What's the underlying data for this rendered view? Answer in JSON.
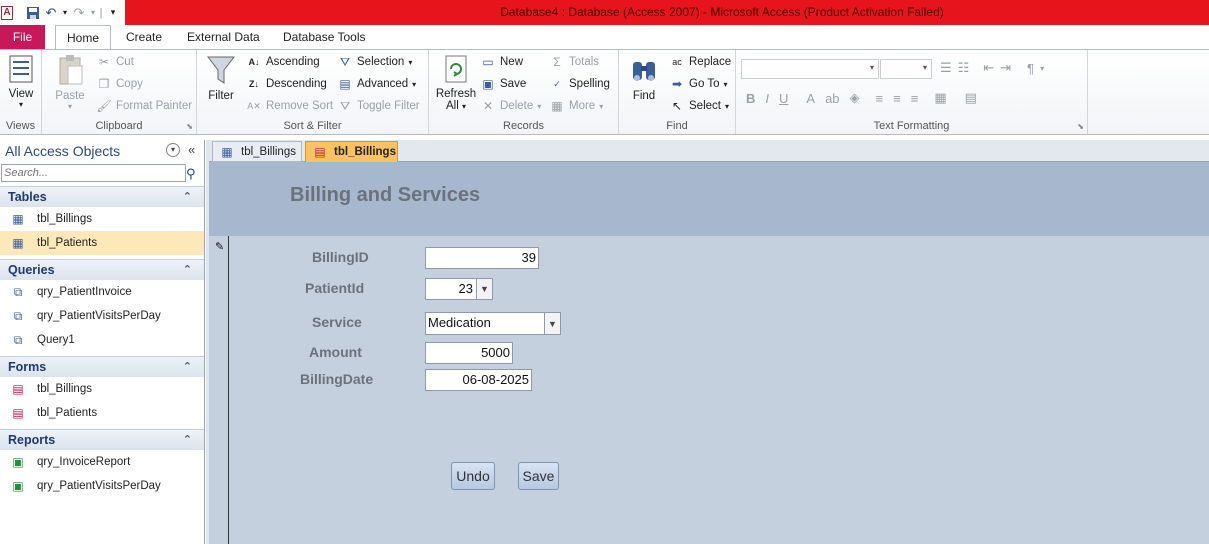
{
  "window": {
    "title": "Database4 : Database (Access 2007)  -  Microsoft Access (Product Activation Failed)"
  },
  "ribbon_tabs": [
    "File",
    "Home",
    "Create",
    "External Data",
    "Database Tools"
  ],
  "ribbon": {
    "views": {
      "view": "View",
      "label": "Views"
    },
    "clipboard": {
      "paste": "Paste",
      "cut": "Cut",
      "copy": "Copy",
      "format_painter": "Format Painter",
      "label": "Clipboard"
    },
    "sort_filter": {
      "filter": "Filter",
      "ascending": "Ascending",
      "descending": "Descending",
      "remove_sort": "Remove Sort",
      "selection": "Selection",
      "advanced": "Advanced",
      "toggle_filter": "Toggle Filter",
      "label": "Sort & Filter"
    },
    "records": {
      "refresh": "Refresh",
      "refresh_all": "All",
      "new": "New",
      "save": "Save",
      "delete": "Delete",
      "totals": "Totals",
      "spelling": "Spelling",
      "more": "More",
      "label": "Records"
    },
    "find": {
      "find": "Find",
      "replace": "Replace",
      "goto": "Go To",
      "select": "Select",
      "label": "Find"
    },
    "text_formatting": {
      "label": "Text Formatting"
    }
  },
  "nav": {
    "header": "All Access Objects",
    "search_placeholder": "Search...",
    "categories": [
      {
        "name": "Tables",
        "items": [
          "tbl_Billings",
          "tbl_Patients"
        ]
      },
      {
        "name": "Queries",
        "items": [
          "qry_PatientInvoice",
          "qry_PatientVisitsPerDay",
          "Query1"
        ]
      },
      {
        "name": "Forms",
        "items": [
          "tbl_Billings",
          "tbl_Patients"
        ]
      },
      {
        "name": "Reports",
        "items": [
          "qry_InvoiceReport",
          "qry_PatientVisitsPerDay"
        ]
      }
    ]
  },
  "doc_tabs": [
    "tbl_Billings",
    "tbl_Billings"
  ],
  "form": {
    "title": "Billing and Services",
    "fields": {
      "billing_id": {
        "label": "BillingID",
        "value": "39"
      },
      "patient_id": {
        "label": "PatientId",
        "value": "23"
      },
      "service": {
        "label": "Service",
        "value": "Medication"
      },
      "amount": {
        "label": "Amount",
        "value": "5000"
      },
      "billing_date": {
        "label": "BillingDate",
        "value": "06-08-2025"
      }
    },
    "buttons": {
      "undo": "Undo",
      "save": "Save"
    }
  }
}
